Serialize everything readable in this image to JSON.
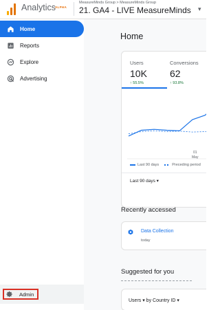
{
  "header": {
    "app_name": "Analytics",
    "badge": "ALPHA",
    "account_breadcrumb": "MeasureMinds Group > MeasureMinds Group",
    "property_name": "21. GA4 - LIVE MeasureMinds",
    "property_caret": "▾",
    "logo_colors": [
      "#f9ab00",
      "#e37400",
      "#e37400"
    ]
  },
  "sidebar": {
    "items": [
      {
        "label": "Home",
        "icon": "home-icon",
        "active": true
      },
      {
        "label": "Reports",
        "icon": "reports-icon"
      },
      {
        "label": "Explore",
        "icon": "explore-icon"
      },
      {
        "label": "Advertising",
        "icon": "advertising-icon"
      }
    ],
    "admin": {
      "label": "Admin",
      "icon": "gear-icon"
    }
  },
  "main": {
    "title": "Home",
    "metrics": [
      {
        "label": "Users",
        "value": "10K",
        "delta": "↑ 55.5%"
      },
      {
        "label": "Conversions",
        "value": "62",
        "delta": "↑ 93.8%"
      }
    ],
    "x_tick_day": "01",
    "x_tick_month": "May",
    "legend": {
      "current": "Last 90 days",
      "previous": "Preceding period"
    },
    "range_dropdown": "Last 90 days ▾",
    "recently_accessed_title": "Recently accessed",
    "recent_item": {
      "name": "Data Collection",
      "time": "today"
    },
    "suggested_title": "Suggested for you",
    "suggested_card_text": "Users ▾ by Country ID ▾",
    "accent_color": "#1a73e8",
    "positive_color": "#137333"
  },
  "chart_data": {
    "type": "line",
    "series": [
      {
        "name": "Last 90 days",
        "values": [
          45,
          58,
          60,
          58,
          57,
          82,
          92,
          120
        ],
        "style": "solid"
      },
      {
        "name": "Preceding period",
        "values": [
          50,
          55,
          57,
          55,
          56,
          54,
          55,
          56
        ],
        "style": "dashed"
      }
    ],
    "x_tick_labels": [
      "01 May"
    ],
    "grid": false
  }
}
